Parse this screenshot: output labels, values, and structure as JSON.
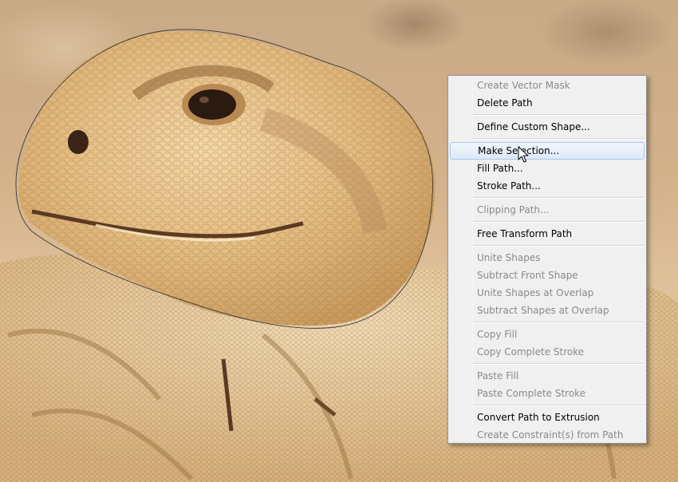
{
  "background": {
    "subject": "lizard-photo",
    "path_outline_color": "#3a3a3a"
  },
  "context_menu": {
    "items": [
      {
        "label": "Create Vector Mask",
        "enabled": false
      },
      {
        "label": "Delete Path",
        "enabled": true
      },
      {
        "label": "Define Custom Shape...",
        "enabled": true
      },
      {
        "label": "Make Selection...",
        "enabled": true,
        "highlighted": true
      },
      {
        "label": "Fill Path...",
        "enabled": true
      },
      {
        "label": "Stroke Path...",
        "enabled": true
      },
      {
        "label": "Clipping Path...",
        "enabled": false
      },
      {
        "label": "Free Transform Path",
        "enabled": true
      },
      {
        "label": "Unite Shapes",
        "enabled": false
      },
      {
        "label": "Subtract Front Shape",
        "enabled": false
      },
      {
        "label": "Unite Shapes at Overlap",
        "enabled": false
      },
      {
        "label": "Subtract Shapes at Overlap",
        "enabled": false
      },
      {
        "label": "Copy Fill",
        "enabled": false
      },
      {
        "label": "Copy Complete Stroke",
        "enabled": false
      },
      {
        "label": "Paste Fill",
        "enabled": false
      },
      {
        "label": "Paste Complete Stroke",
        "enabled": false
      },
      {
        "label": "Convert Path to Extrusion",
        "enabled": true
      },
      {
        "label": "Create Constraint(s) from Path",
        "enabled": false
      }
    ],
    "highlight_color": "#dde9f8",
    "disabled_text_color": "#8a8a8a"
  },
  "cursor": {
    "icon": "arrow-pointer-icon"
  }
}
